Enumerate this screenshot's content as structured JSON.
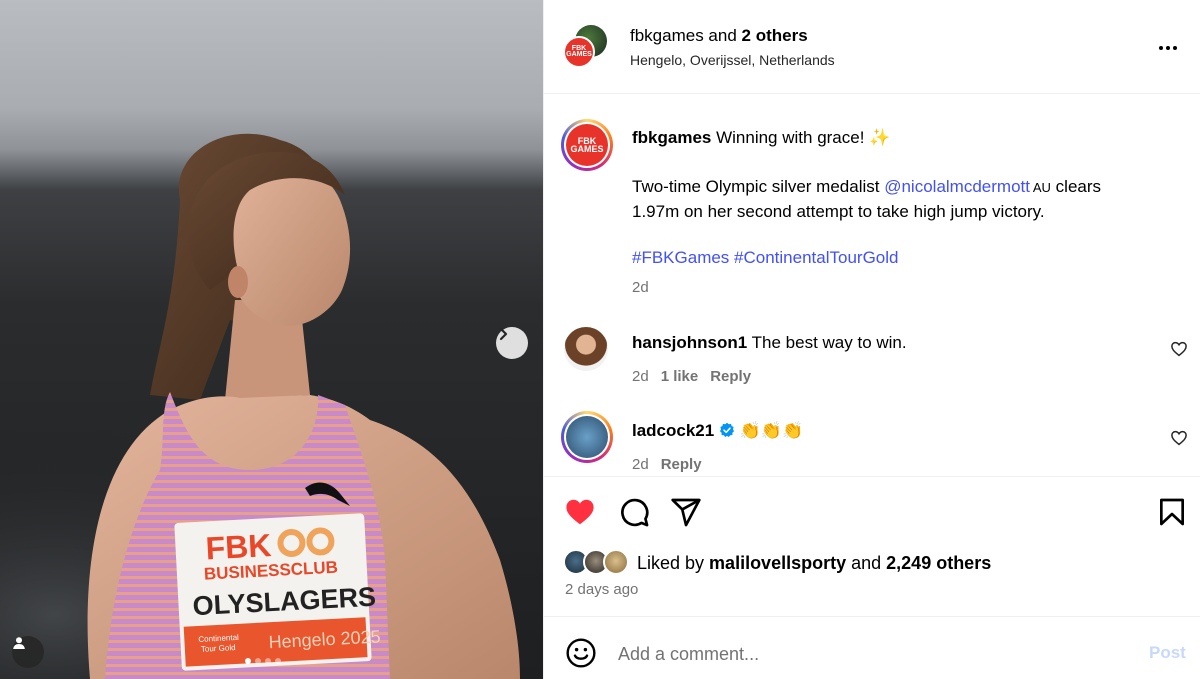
{
  "header": {
    "account": "fbkgames",
    "and_text": " and ",
    "others": "2 others",
    "location": "Hengelo, Overijssel, Netherlands",
    "more_icon": "more-horizontal-icon"
  },
  "brand": {
    "avatar_text_1": "FBK",
    "avatar_text_2": "GAMES",
    "color": "#e8332b"
  },
  "caption": {
    "username": "fbkgames",
    "line1": " Winning with grace! ✨",
    "line2_a": "Two-time Olympic silver medalist ",
    "mention": "@nicolalmcdermott",
    "flag": " AU",
    "line2_b": " clears",
    "line3": "1.97m on her second attempt to take high jump victory.",
    "hashtags": "#FBKGames #ContinentalTourGold",
    "time": "2d"
  },
  "comments": [
    {
      "username": "hansjohnson1",
      "text": " The best way to win.",
      "time": "2d",
      "likes": "1 like",
      "reply": "Reply"
    },
    {
      "username": "ladcock21",
      "text": " 👏👏👏",
      "time": "2d",
      "reply": "Reply"
    }
  ],
  "actions": {
    "like_color": "#ff3040",
    "liked_by_prefix": "Liked by ",
    "liked_by_user": "malilovellsporty",
    "liked_by_mid": " and ",
    "liked_by_count": "2,249 others",
    "posted": "2 days ago"
  },
  "composer": {
    "placeholder": "Add a comment...",
    "post_label": "Post"
  },
  "photo": {
    "bib_line1": "FBK",
    "bib_line2": "BUSINESSCLUB",
    "bib_name": "OLYSLAGERS",
    "bib_event": "Hengelo 2025",
    "bib_tour_1": "Continental",
    "bib_tour_2": "Tour Gold",
    "carousel_position": 1,
    "carousel_total": 4
  }
}
